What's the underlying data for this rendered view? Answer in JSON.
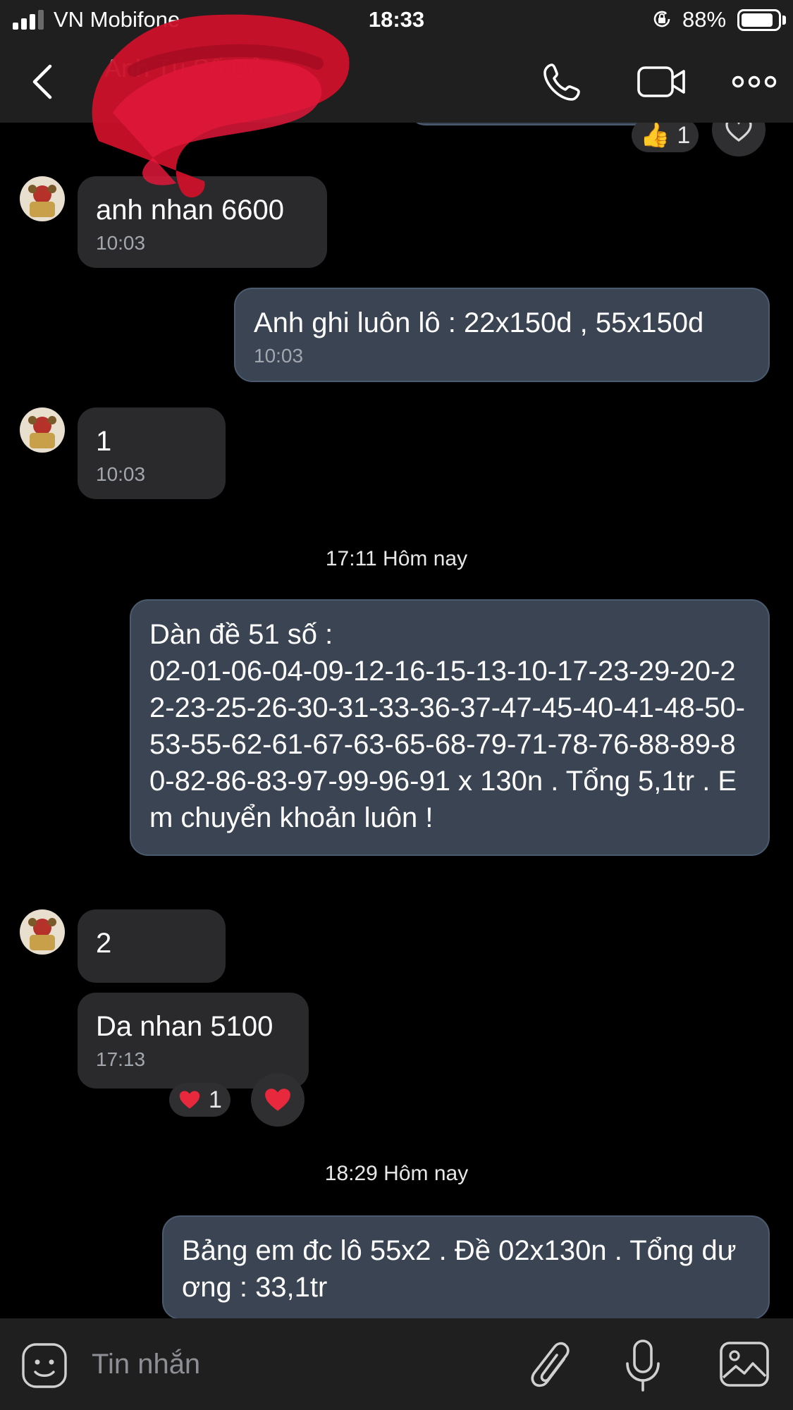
{
  "status_bar": {
    "carrier": "VN Mobifone",
    "time": "18:33",
    "battery": "88%",
    "battery_level": 0.88,
    "signal_bars": 3
  },
  "header": {
    "contact_name": "Anh Tú Sổ Đỏ",
    "icons": [
      "back-icon",
      "phone-icon",
      "video-icon",
      "more-icon"
    ]
  },
  "top_reaction": {
    "emoji": "👍",
    "count": "1"
  },
  "messages": [
    {
      "side": "in",
      "text": "anh nhan 6600",
      "time": "10:03"
    },
    {
      "side": "out",
      "text": "Anh ghi luôn lô : 22x150d , 55x150d",
      "time": "10:03"
    },
    {
      "side": "in",
      "text": "1",
      "time": "10:03"
    },
    {
      "side": "out",
      "text": "Dàn đề 51 số :\n02-01-06-04-09-12-16-15-13-10-17-23-29-20-22-23-25-26-30-31-33-36-37-47-45-40-41-48-50-53-55-62-61-67-63-65-68-79-71-78-76-88-89-80-82-86-83-97-99-96-91 x 130n . Tổng 5,1tr . Em chuyển khoản luôn !"
    },
    {
      "side": "in",
      "text": "2"
    },
    {
      "side": "in",
      "text": "Da nhan 5100",
      "time": "17:13"
    },
    {
      "side": "out",
      "text": "Bảng em đc lô 55x2 . Đề 02x130n . Tổng dương : 33,1tr"
    }
  ],
  "date_separators": [
    "17:11 Hôm nay",
    "18:29 Hôm nay"
  ],
  "message_reaction": {
    "emoji": "❤️",
    "count": "1"
  },
  "input": {
    "placeholder": "Tin nhắn"
  },
  "colors": {
    "bar_background": "#1f1f1f",
    "incoming_bubble": "#2a2a2c",
    "outgoing_bubble": "#3a4453",
    "timestamp": "#a2a6ad",
    "heart": "#e8283c"
  }
}
